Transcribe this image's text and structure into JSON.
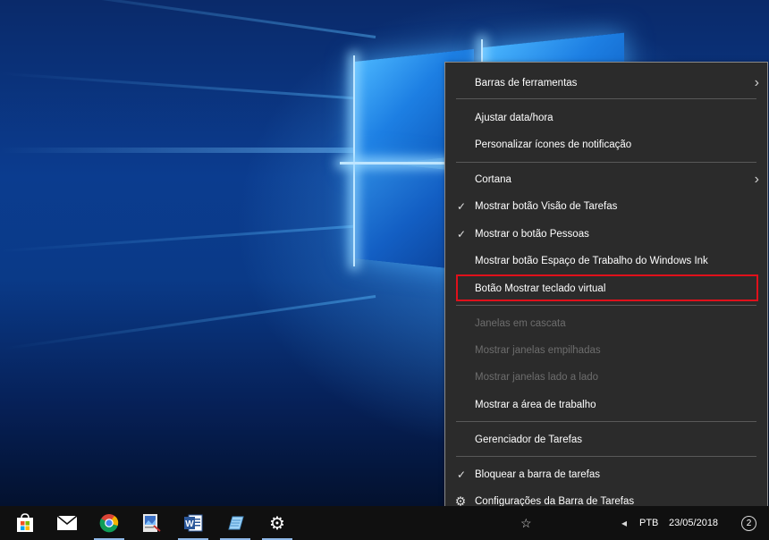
{
  "menu": {
    "items": [
      {
        "label": "Barras de ferramentas",
        "submenu": true
      },
      {
        "label": "Ajustar data/hora"
      },
      {
        "label": "Personalizar ícones de notificação"
      },
      {
        "label": "Cortana",
        "submenu": true
      },
      {
        "label": "Mostrar botão Visão de Tarefas",
        "checked": true
      },
      {
        "label": "Mostrar o botão Pessoas",
        "checked": true
      },
      {
        "label": "Mostrar botão Espaço de Trabalho do Windows Ink"
      },
      {
        "label": "Botão Mostrar teclado virtual",
        "highlighted": true
      },
      {
        "label": "Janelas em cascata",
        "disabled": true
      },
      {
        "label": "Mostrar janelas empilhadas",
        "disabled": true
      },
      {
        "label": "Mostrar janelas lado a lado",
        "disabled": true
      },
      {
        "label": "Mostrar a área de trabalho"
      },
      {
        "label": "Gerenciador de Tarefas"
      },
      {
        "label": "Bloquear a barra de tarefas",
        "checked": true
      },
      {
        "label": "Configurações da Barra de Tarefas",
        "icon": "gear-icon"
      }
    ],
    "highlight_color": "#e0101b"
  },
  "taskbar": {
    "apps": [
      {
        "name": "microsoft-store-icon"
      },
      {
        "name": "mail-icon"
      },
      {
        "name": "chrome-icon",
        "active": true
      },
      {
        "name": "photo-editor-icon"
      },
      {
        "name": "word-icon",
        "active": true
      },
      {
        "name": "notepad-icon",
        "active": true
      },
      {
        "name": "settings-icon",
        "active": true
      }
    ],
    "language": "PTB",
    "date": "23/05/2018",
    "notification_count": "2"
  }
}
